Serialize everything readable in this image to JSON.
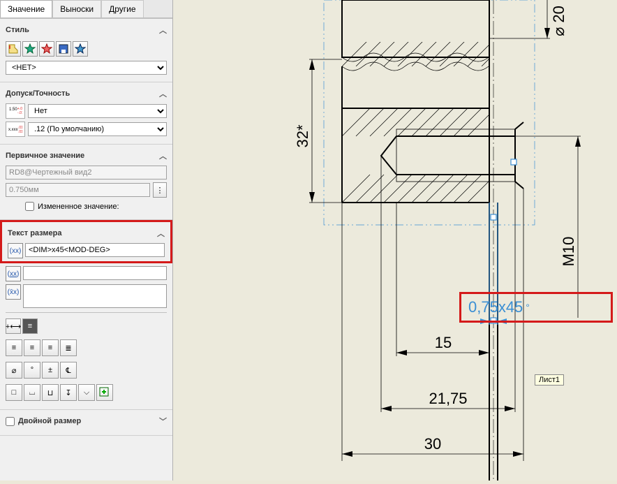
{
  "tabs": {
    "t0": "Значение",
    "t1": "Выноски",
    "t2": "Другие"
  },
  "style": {
    "header": "Стиль",
    "select": "<НЕТ>"
  },
  "tolerance": {
    "header": "Допуск/Точность",
    "type": "Нет",
    "precision": ".12 (По умолчанию)"
  },
  "primary": {
    "header": "Первичное значение",
    "ref": "RD8@Чертежный вид2",
    "value": "0.750мм",
    "override_label": "Измененное значение:"
  },
  "dim_text": {
    "header": "Текст размера",
    "main": "<DIM>x45<MOD-DEG>",
    "prefix": "",
    "below": ""
  },
  "dual": {
    "header": "Двойной размер"
  },
  "canvas": {
    "val": "0,75x45",
    "d15": "15",
    "d2175": "21,75",
    "d30": "30",
    "d32": "32*",
    "m10": "M10",
    "dia20": "⌀ 20",
    "tooltip": "Лист1"
  }
}
